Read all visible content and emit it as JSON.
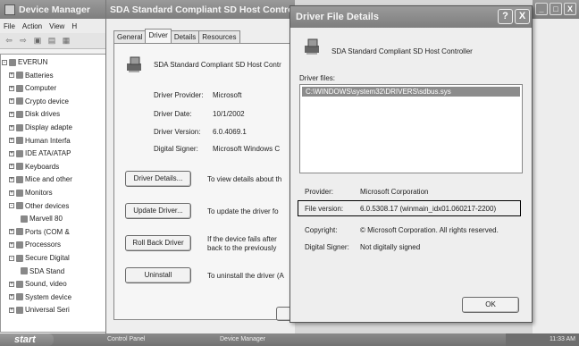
{
  "device_manager": {
    "title": "Device Manager",
    "menu": [
      "File",
      "Action",
      "View",
      "H"
    ],
    "tree": [
      {
        "label": "EVERUN",
        "expand": "-"
      },
      {
        "label": "Batteries",
        "expand": "+"
      },
      {
        "label": "Computer",
        "expand": "+"
      },
      {
        "label": "Crypto device",
        "expand": "+"
      },
      {
        "label": "Disk drives",
        "expand": "+"
      },
      {
        "label": "Display adapte",
        "expand": "+"
      },
      {
        "label": "Human Interfa",
        "expand": "+"
      },
      {
        "label": "IDE ATA/ATAP",
        "expand": "+"
      },
      {
        "label": "Keyboards",
        "expand": "+"
      },
      {
        "label": "Mice and other",
        "expand": "+"
      },
      {
        "label": "Monitors",
        "expand": "+"
      },
      {
        "label": "Other devices",
        "expand": "-"
      },
      {
        "label": "Marvell 80",
        "expand": ""
      },
      {
        "label": "Ports (COM &",
        "expand": "+"
      },
      {
        "label": "Processors",
        "expand": "+"
      },
      {
        "label": "Secure Digital",
        "expand": "-"
      },
      {
        "label": "SDA Stand",
        "expand": ""
      },
      {
        "label": "Sound, video",
        "expand": "+"
      },
      {
        "label": "System device",
        "expand": "+"
      },
      {
        "label": "Universal Seri",
        "expand": "+"
      }
    ]
  },
  "properties": {
    "title": "SDA Standard Compliant SD Host Controll",
    "tabs": [
      "General",
      "Driver",
      "Details",
      "Resources"
    ],
    "device_name": "SDA Standard Compliant SD Host Contr",
    "fields": [
      {
        "label": "Driver Provider:",
        "value": "Microsoft"
      },
      {
        "label": "Driver Date:",
        "value": "10/1/2002"
      },
      {
        "label": "Driver Version:",
        "value": "6.0.4069.1"
      },
      {
        "label": "Digital Signer:",
        "value": "Microsoft Windows C"
      }
    ],
    "actions": [
      {
        "button": "Driver Details...",
        "desc": "To view details about th"
      },
      {
        "button": "Update Driver...",
        "desc": "To update the driver fo"
      },
      {
        "button": "Roll Back Driver",
        "desc": "If the device fails after",
        "desc2": "back to the previously"
      },
      {
        "button": "Uninstall",
        "desc": "To uninstall the driver (A"
      }
    ]
  },
  "dialog": {
    "title": "Driver File Details",
    "help_glyph": "?",
    "close_glyph": "X",
    "device_name": "SDA Standard Compliant SD Host Controller",
    "files_label": "Driver files:",
    "files": [
      "C:\\WINDOWS\\system32\\DRIVERS\\sdbus.sys"
    ],
    "provider_label": "Provider:",
    "provider": "Microsoft Corporation",
    "version_label": "File version:",
    "version": "6.0.5308.17 (winmain_idx01.060217-2200)",
    "copyright_label": "Copyright:",
    "copyright": "© Microsoft Corporation. All rights reserved.",
    "signer_label": "Digital Signer:",
    "signer": "Not digitally signed",
    "ok_label": "OK"
  },
  "background_window": {
    "minimize": "_",
    "maximize": "□",
    "close": "X"
  },
  "taskbar": {
    "start": "start",
    "tasks": [
      "Control Panel",
      "Device Manager"
    ],
    "clock": "11:33 AM"
  }
}
